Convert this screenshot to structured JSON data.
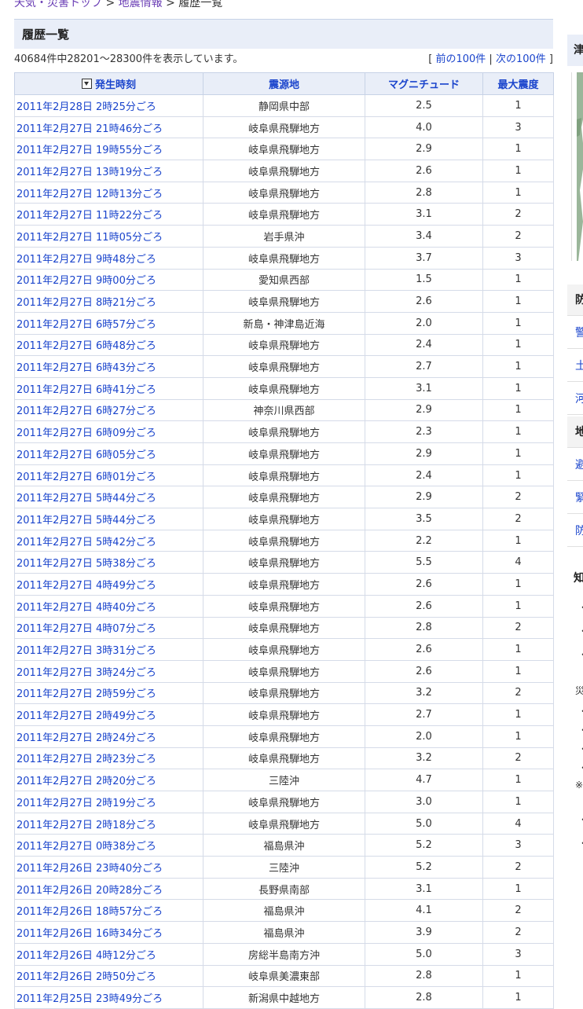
{
  "breadcrumb": {
    "items": [
      "天気・災害トップ",
      "地震情報"
    ],
    "current": "履歴一覧",
    "sep": ">"
  },
  "section": {
    "title": "履歴一覧"
  },
  "summary": {
    "text": "40684件中28201〜28300件を表示しています。",
    "open": "[",
    "prev": "前の100件",
    "divider": "|",
    "next": "次の100件",
    "close": "]"
  },
  "table": {
    "headers": {
      "time": "発生時刻",
      "epicenter": "震源地",
      "magnitude": "マグニチュード",
      "intensity": "最大震度"
    },
    "rows": [
      [
        "2011年2月28日 2時25分ごろ",
        "静岡県中部",
        "2.5",
        "1"
      ],
      [
        "2011年2月27日 21時46分ごろ",
        "岐阜県飛騨地方",
        "4.0",
        "3"
      ],
      [
        "2011年2月27日 19時55分ごろ",
        "岐阜県飛騨地方",
        "2.9",
        "1"
      ],
      [
        "2011年2月27日 13時19分ごろ",
        "岐阜県飛騨地方",
        "2.6",
        "1"
      ],
      [
        "2011年2月27日 12時13分ごろ",
        "岐阜県飛騨地方",
        "2.8",
        "1"
      ],
      [
        "2011年2月27日 11時22分ごろ",
        "岐阜県飛騨地方",
        "3.1",
        "2"
      ],
      [
        "2011年2月27日 11時05分ごろ",
        "岩手県沖",
        "3.4",
        "2"
      ],
      [
        "2011年2月27日 9時48分ごろ",
        "岐阜県飛騨地方",
        "3.7",
        "3"
      ],
      [
        "2011年2月27日 9時00分ごろ",
        "愛知県西部",
        "1.5",
        "1"
      ],
      [
        "2011年2月27日 8時21分ごろ",
        "岐阜県飛騨地方",
        "2.6",
        "1"
      ],
      [
        "2011年2月27日 6時57分ごろ",
        "新島・神津島近海",
        "2.0",
        "1"
      ],
      [
        "2011年2月27日 6時48分ごろ",
        "岐阜県飛騨地方",
        "2.4",
        "1"
      ],
      [
        "2011年2月27日 6時43分ごろ",
        "岐阜県飛騨地方",
        "2.7",
        "1"
      ],
      [
        "2011年2月27日 6時41分ごろ",
        "岐阜県飛騨地方",
        "3.1",
        "1"
      ],
      [
        "2011年2月27日 6時27分ごろ",
        "神奈川県西部",
        "2.9",
        "1"
      ],
      [
        "2011年2月27日 6時09分ごろ",
        "岐阜県飛騨地方",
        "2.3",
        "1"
      ],
      [
        "2011年2月27日 6時05分ごろ",
        "岐阜県飛騨地方",
        "2.9",
        "1"
      ],
      [
        "2011年2月27日 6時01分ごろ",
        "岐阜県飛騨地方",
        "2.4",
        "1"
      ],
      [
        "2011年2月27日 5時44分ごろ",
        "岐阜県飛騨地方",
        "2.9",
        "2"
      ],
      [
        "2011年2月27日 5時44分ごろ",
        "岐阜県飛騨地方",
        "3.5",
        "2"
      ],
      [
        "2011年2月27日 5時42分ごろ",
        "岐阜県飛騨地方",
        "2.2",
        "1"
      ],
      [
        "2011年2月27日 5時38分ごろ",
        "岐阜県飛騨地方",
        "5.5",
        "4"
      ],
      [
        "2011年2月27日 4時49分ごろ",
        "岐阜県飛騨地方",
        "2.6",
        "1"
      ],
      [
        "2011年2月27日 4時40分ごろ",
        "岐阜県飛騨地方",
        "2.6",
        "1"
      ],
      [
        "2011年2月27日 4時07分ごろ",
        "岐阜県飛騨地方",
        "2.8",
        "2"
      ],
      [
        "2011年2月27日 3時31分ごろ",
        "岐阜県飛騨地方",
        "2.6",
        "1"
      ],
      [
        "2011年2月27日 3時24分ごろ",
        "岐阜県飛騨地方",
        "2.6",
        "1"
      ],
      [
        "2011年2月27日 2時59分ごろ",
        "岐阜県飛騨地方",
        "3.2",
        "2"
      ],
      [
        "2011年2月27日 2時49分ごろ",
        "岐阜県飛騨地方",
        "2.7",
        "1"
      ],
      [
        "2011年2月27日 2時24分ごろ",
        "岐阜県飛騨地方",
        "2.0",
        "1"
      ],
      [
        "2011年2月27日 2時23分ごろ",
        "岐阜県飛騨地方",
        "3.2",
        "2"
      ],
      [
        "2011年2月27日 2時20分ごろ",
        "三陸沖",
        "4.7",
        "1"
      ],
      [
        "2011年2月27日 2時19分ごろ",
        "岐阜県飛騨地方",
        "3.0",
        "1"
      ],
      [
        "2011年2月27日 2時18分ごろ",
        "岐阜県飛騨地方",
        "5.0",
        "4"
      ],
      [
        "2011年2月27日 0時38分ごろ",
        "福島県沖",
        "5.2",
        "3"
      ],
      [
        "2011年2月26日 23時40分ごろ",
        "三陸沖",
        "5.2",
        "2"
      ],
      [
        "2011年2月26日 20時28分ごろ",
        "長野県南部",
        "3.1",
        "1"
      ],
      [
        "2011年2月26日 18時57分ごろ",
        "福島県沖",
        "4.1",
        "2"
      ],
      [
        "2011年2月26日 16時34分ごろ",
        "福島県沖",
        "3.9",
        "2"
      ],
      [
        "2011年2月26日 4時12分ごろ",
        "房総半島南方沖",
        "5.0",
        "3"
      ],
      [
        "2011年2月26日 2時50分ごろ",
        "岐阜県美濃東部",
        "2.8",
        "1"
      ],
      [
        "2011年2月25日 23時49分ごろ",
        "新潟県中越地方",
        "2.8",
        "1"
      ]
    ]
  },
  "sidebar": {
    "head1": "津",
    "cat1": "防",
    "links1": [
      "警",
      "土",
      "河"
    ],
    "cat2": "地",
    "links2": [
      "避",
      "緊",
      "防"
    ],
    "head2": "知",
    "misc1": "災",
    "misc2": "※",
    "bullet": "・",
    "colors": {
      "link": "#1a44cc",
      "header_bg": "#e9eef8",
      "visited": "#6b3fb5"
    }
  }
}
